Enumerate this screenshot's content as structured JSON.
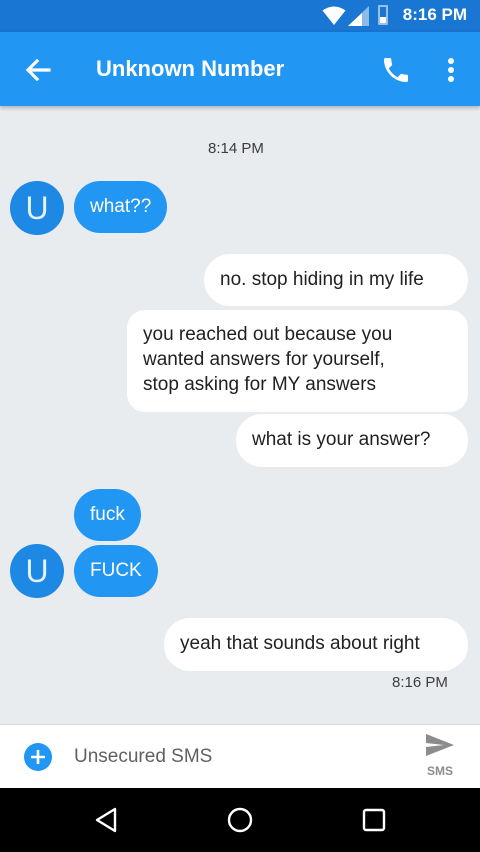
{
  "status_bar": {
    "time": "8:16 PM",
    "battery_level": 0.35,
    "icons": [
      "wifi-icon",
      "signal-icon",
      "battery-icon"
    ]
  },
  "app_bar": {
    "title": "Unknown Number",
    "icons": [
      "back-arrow-icon",
      "phone-icon",
      "more-vert-icon"
    ]
  },
  "thread": {
    "timestamp_top": "8:14 PM",
    "avatar_letter": "U",
    "messages": [
      {
        "dir": "in",
        "text": "what??"
      },
      {
        "dir": "out",
        "text": "no. stop hiding in my life"
      },
      {
        "dir": "out",
        "lines": [
          "you reached out because you",
          "wanted answers for yourself,",
          "stop asking for MY answers"
        ]
      },
      {
        "dir": "out",
        "text": "what is your answer?"
      },
      {
        "dir": "in",
        "text": "fuck"
      },
      {
        "dir": "in",
        "text": "FUCK"
      },
      {
        "dir": "out",
        "text": "yeah that sounds about right"
      }
    ],
    "timestamp_bottom": "8:16 PM"
  },
  "compose": {
    "placeholder": "Unsecured SMS",
    "send_label": "SMS"
  },
  "colors": {
    "primary": "#2196f3",
    "status": "#1976d2",
    "incoming": "#2196f3",
    "outgoing": "#ffffff",
    "background": "#e9ecef"
  }
}
